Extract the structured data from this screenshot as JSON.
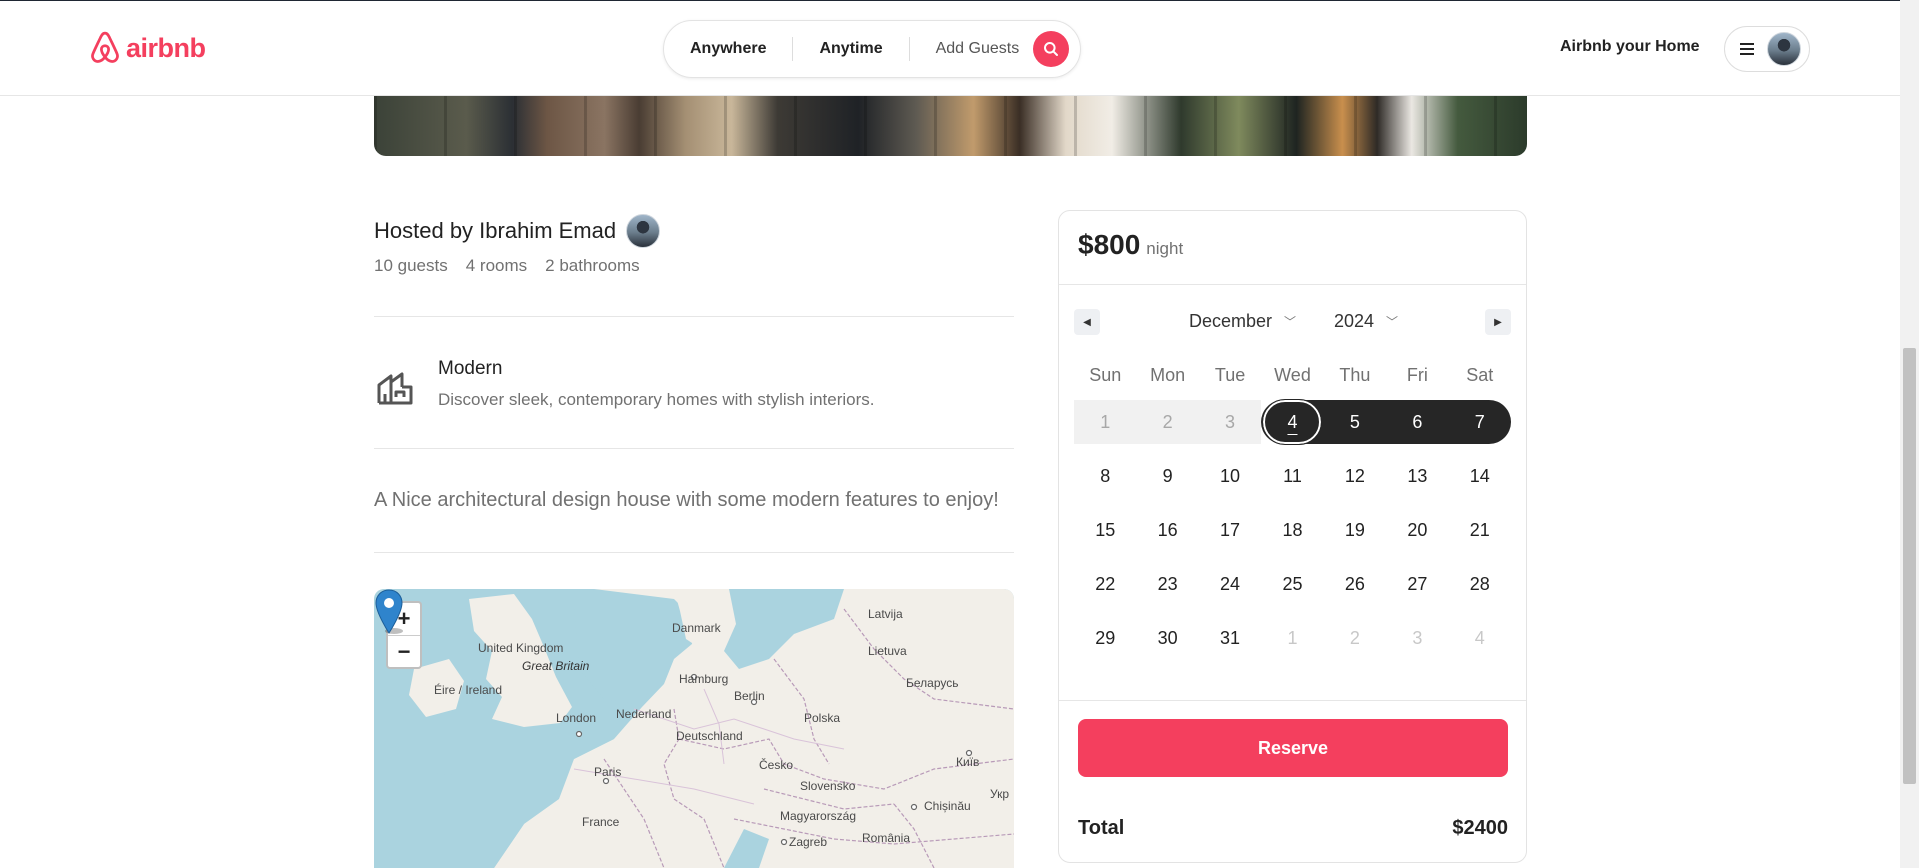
{
  "nav": {
    "brand": "airbnb",
    "search": {
      "where": "Anywhere",
      "when": "Anytime",
      "guests": "Add Guests"
    },
    "host_link": "Airbnb your Home"
  },
  "listing": {
    "host_title": "Hosted by Ibrahim Emad",
    "stats": {
      "guests": "10 guests",
      "rooms": "4 rooms",
      "bathrooms": "2 bathrooms"
    },
    "category": {
      "name": "Modern",
      "description": "Discover sleek, contemporary homes with stylish interiors."
    },
    "description": "A Nice architectural design house with some modern features to enjoy!"
  },
  "map": {
    "zoom_in": "+",
    "zoom_out": "−",
    "labels": {
      "latvija": "Latvija",
      "danmark": "Danmark",
      "uk": "United Kingdom",
      "great_britain": "Great Britain",
      "lietuva": "Lietuva",
      "eire": "Éire / Ireland",
      "hamburg": "Hamburg",
      "berlin": "Berlin",
      "belarus": "Беларусь",
      "london": "London",
      "nederland": "Nederland",
      "polska": "Polska",
      "deutschland": "Deutschland",
      "kyiv": "Київ",
      "cesko": "Česko",
      "slovensko": "Slovensko",
      "paris": "Paris",
      "ukr": "Укр",
      "chisinau": "Chișinău",
      "magyarorszag": "Magyarország",
      "france": "France",
      "romania": "România",
      "zagreb": "Zagreb"
    }
  },
  "booking": {
    "price": "$800",
    "per": "night",
    "month": "December",
    "year": "2024",
    "weekdays": [
      "Sun",
      "Mon",
      "Tue",
      "Wed",
      "Thu",
      "Fri",
      "Sat"
    ],
    "days": [
      "1",
      "2",
      "3",
      "4",
      "5",
      "6",
      "7",
      "8",
      "9",
      "10",
      "11",
      "12",
      "13",
      "14",
      "15",
      "16",
      "17",
      "18",
      "19",
      "20",
      "21",
      "22",
      "23",
      "24",
      "25",
      "26",
      "27",
      "28",
      "29",
      "30",
      "31",
      "1",
      "2",
      "3",
      "4"
    ],
    "reserve_label": "Reserve",
    "total_label": "Total",
    "total_value": "$2400"
  },
  "colors": {
    "brand": "#f43f5e",
    "selected": "#262626"
  }
}
